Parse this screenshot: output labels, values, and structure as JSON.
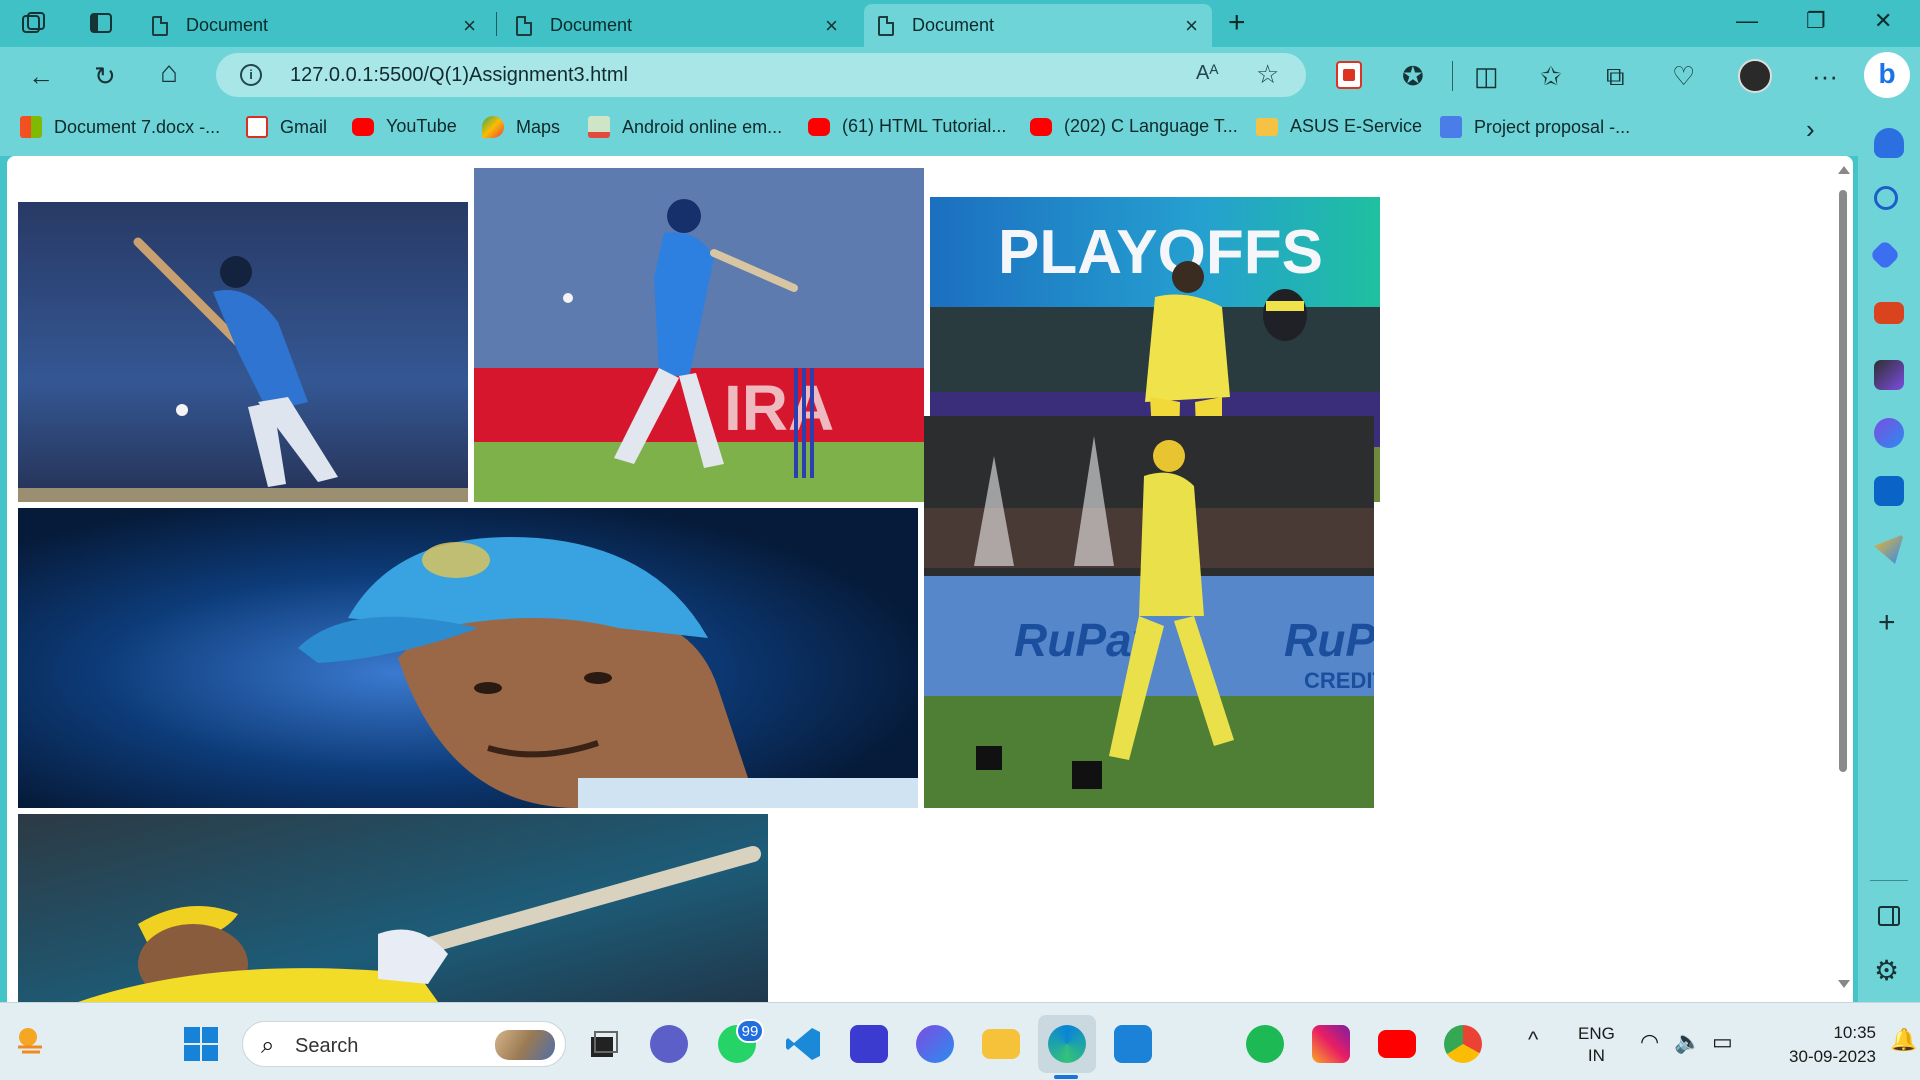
{
  "browser": {
    "tabs": [
      {
        "title": "Document",
        "close": "×"
      },
      {
        "title": "Document",
        "close": "×"
      },
      {
        "title": "Document",
        "close": "×"
      }
    ],
    "new_tab": "+",
    "window_controls": {
      "minimize": "—",
      "restore": "❐",
      "close": "✕"
    },
    "nav": {
      "back": "←",
      "reload": "↻",
      "home": "⌂"
    },
    "address_bar": {
      "url": "127.0.0.1:5500/Q(1)Assignment3.html",
      "info": "i",
      "read_aloud": "Aᴬ",
      "favorite": "☆"
    },
    "toolbar_icons": {
      "extensions": "✪",
      "split": "◫",
      "favorites": "✩",
      "collections": "⧉",
      "health": "♡",
      "more": "···",
      "copilot": "b"
    }
  },
  "bookmarks": [
    {
      "label": "Document 7.docx -...",
      "icon": "microsoft-icon"
    },
    {
      "label": "Gmail",
      "icon": "gmail-icon"
    },
    {
      "label": "YouTube",
      "icon": "youtube-icon"
    },
    {
      "label": "Maps",
      "icon": "maps-icon"
    },
    {
      "label": "Android online em...",
      "icon": "android-icon"
    },
    {
      "label": "(61) HTML Tutorial...",
      "icon": "youtube-icon"
    },
    {
      "label": "(202) C Language T...",
      "icon": "youtube-icon"
    },
    {
      "label": "ASUS E-Service",
      "icon": "folder-icon"
    },
    {
      "label": "Project proposal -...",
      "icon": "docs-icon"
    }
  ],
  "bookmarks_more": "›",
  "page": {
    "images": [
      {
        "name": "photo-batting-india-blue",
        "text": ""
      },
      {
        "name": "photo-shot-india-blue-stumps",
        "text": ""
      },
      {
        "name": "photo-playoffs-keeper",
        "text": "PLAYOFFS"
      },
      {
        "name": "photo-portrait-blue-cap",
        "text": ""
      },
      {
        "name": "photo-walkout-fireworks",
        "text": "RuPay CREDIT"
      },
      {
        "name": "photo-batting-yellow",
        "text": ""
      }
    ]
  },
  "sidebar": {
    "add": "+",
    "settings": "⚙"
  },
  "taskbar": {
    "search_placeholder": "Search",
    "search_icon": "⌕",
    "whatsapp_badge": "99",
    "tray": {
      "chevron": "^",
      "lang_line1": "ENG",
      "lang_line2": "IN",
      "wifi": "◠",
      "volume": "🔈",
      "battery": "▭",
      "notifications": "🔔"
    },
    "time": "10:35",
    "date": "30-09-2023"
  }
}
